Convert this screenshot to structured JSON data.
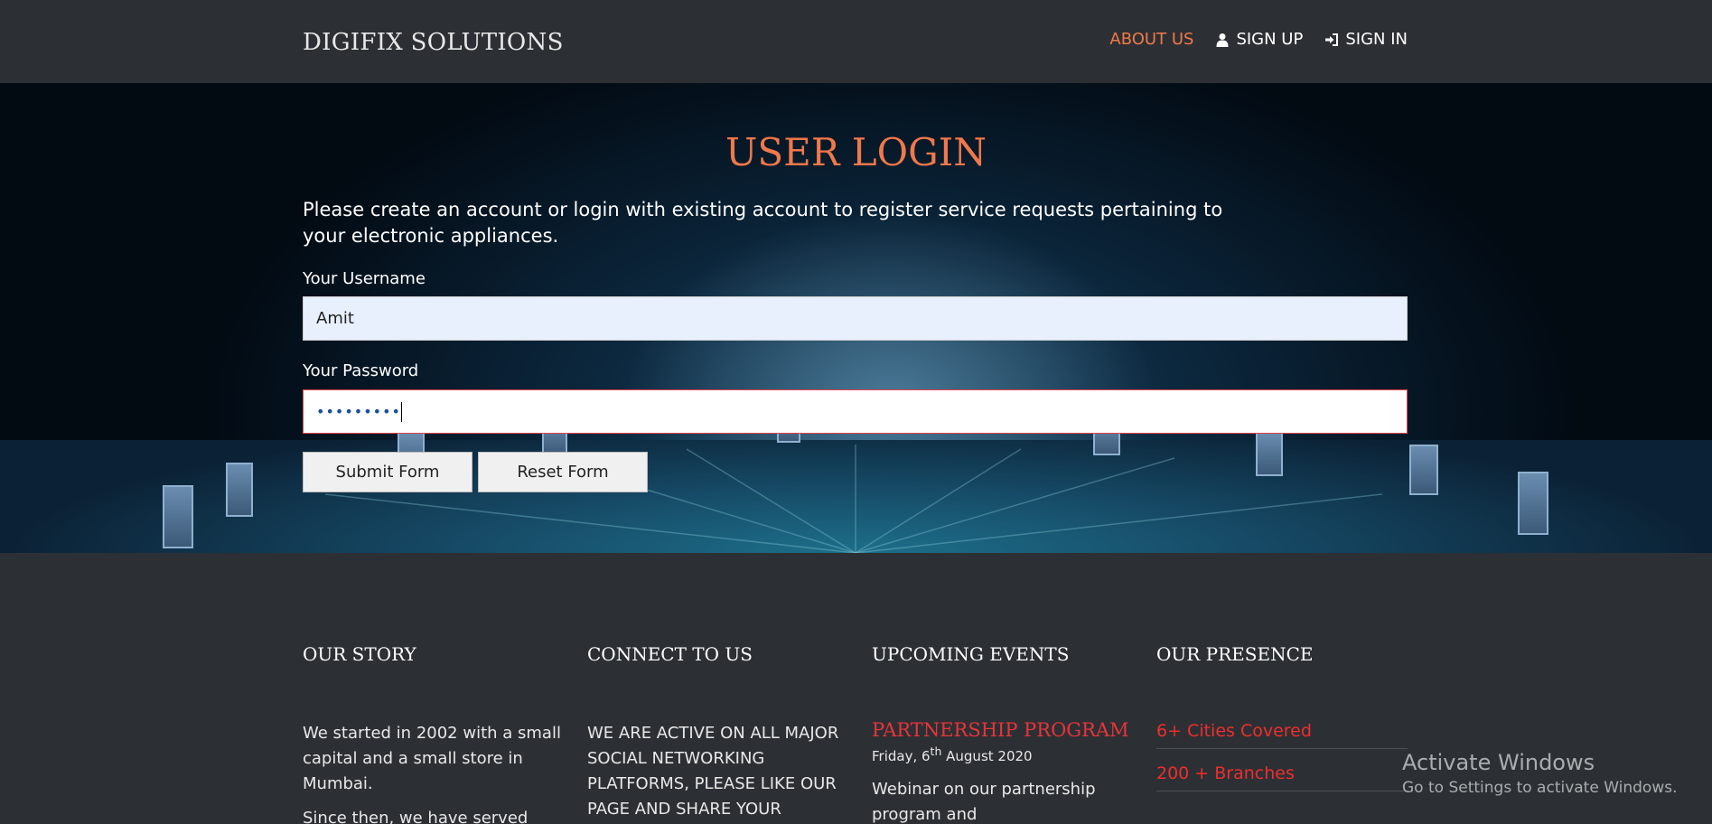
{
  "nav": {
    "brand": "DIGIFIX SOLUTIONS",
    "about": "ABOUT US",
    "signup": "SIGN UP",
    "signin": "SIGN IN",
    "accent_color": "#f0784a"
  },
  "login": {
    "title": "USER LOGIN",
    "intro": "Please create an account or login with existing account to register service requests pertaining to your electronic appliances.",
    "username_label": "Your Username",
    "username_value": "Amit",
    "password_label": "Your Password",
    "password_value": "•••••••••",
    "submit_label": "Submit Form",
    "reset_label": "Reset Form"
  },
  "footer": {
    "story": {
      "heading": "OUR STORY",
      "text1": "We started in 2002 with a small capital and a small store in Mumbai.",
      "text2": "Since then, we have served"
    },
    "connect": {
      "heading": "CONNECT TO US",
      "text": "WE ARE ACTIVE ON ALL MAJOR SOCIAL NETWORKING PLATFORMS, PLEASE LIKE OUR PAGE AND SHARE YOUR"
    },
    "events": {
      "heading": "UPCOMING EVENTS",
      "event_title": "PARTNERSHIP PROGRAM",
      "date_prefix": "Friday, 6",
      "date_sup": "th",
      "date_suffix": " August 2020",
      "description": "Webinar on our partnership program and"
    },
    "presence": {
      "heading": "OUR PRESENCE",
      "items": [
        "6+ Cities Covered",
        "200 + Branches"
      ]
    }
  },
  "watermark": {
    "line1": "Activate Windows",
    "line2": "Go to Settings to activate Windows."
  }
}
